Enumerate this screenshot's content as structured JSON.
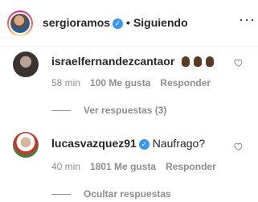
{
  "header": {
    "username": "sergioramos",
    "separator": "•",
    "follow_status": "Siguiendo",
    "more_icon": "ellipsis-icon",
    "verified_icon": "verified-badge-icon",
    "verified_color": "#3897f0"
  },
  "comments": [
    {
      "username": "israelfernandezcantaor",
      "text": "",
      "emoji": [
        "dark-hand",
        "dark-hand",
        "dark-hand"
      ],
      "time": "58 min",
      "likes": "100 Me gusta",
      "reply_label": "Responder",
      "replies_label": "Ver respuestas (3)"
    },
    {
      "username": "lucasvazquez91",
      "text": "Naufrago?",
      "verified": true,
      "time": "40 min",
      "likes": "1801 Me gusta",
      "reply_label": "Responder",
      "replies_label": "Ocultar respuestas"
    }
  ],
  "colors": {
    "text": "#262626",
    "muted": "#8e8e8e",
    "divider": "#efefef"
  }
}
